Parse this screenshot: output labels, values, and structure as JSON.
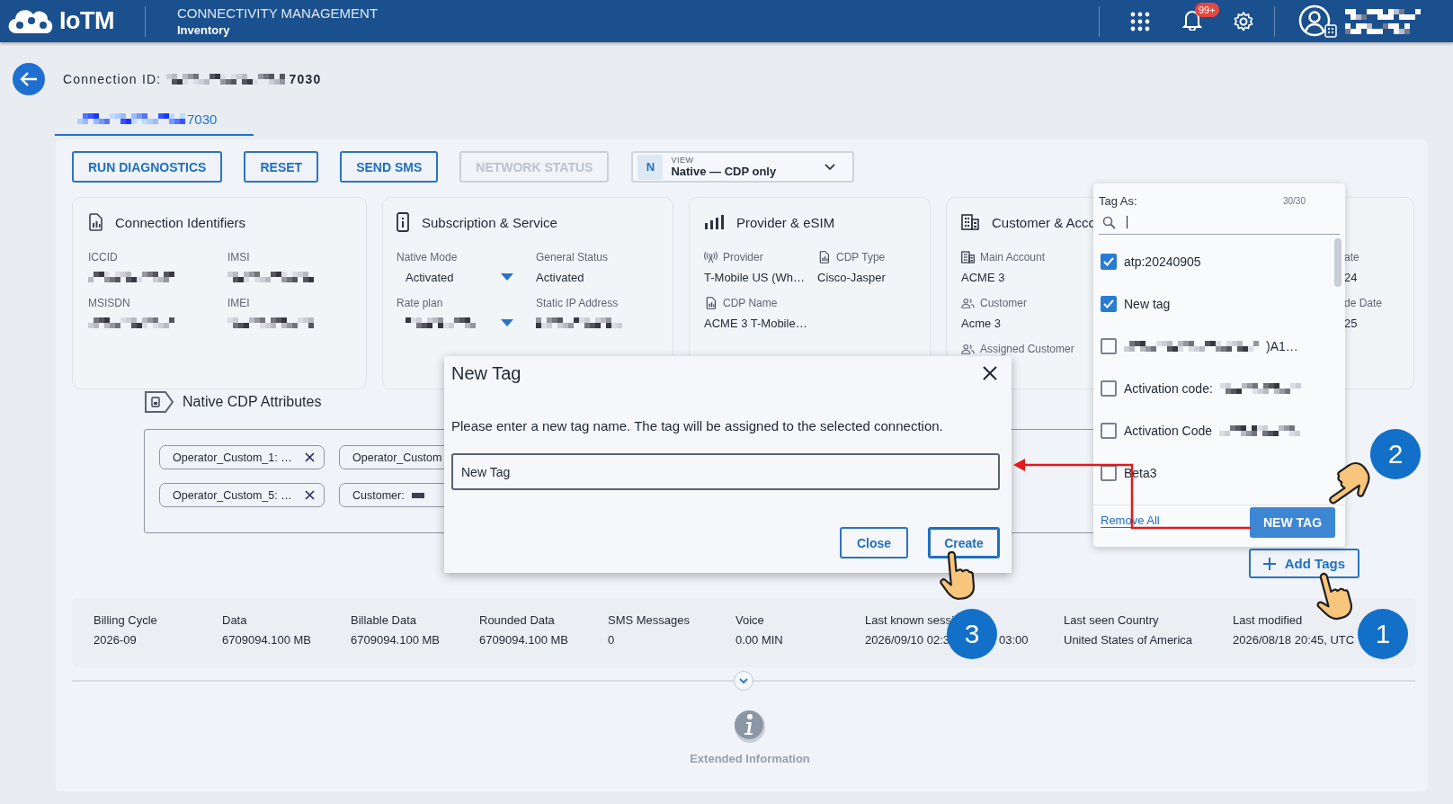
{
  "header": {
    "app_name": "IoTM",
    "section": "CONNECTIVITY MANAGEMENT",
    "page": "Inventory",
    "notification_badge": "99+"
  },
  "connection": {
    "label": "Connection ID:",
    "id_tail": "7030"
  },
  "tab": {
    "label_tail": "7030",
    "selected": true
  },
  "actions": [
    {
      "label": "RUN DIAGNOSTICS",
      "disabled": false
    },
    {
      "label": "RESET",
      "disabled": false
    },
    {
      "label": "SEND SMS",
      "disabled": false
    },
    {
      "label": "NETWORK STATUS",
      "disabled": true
    }
  ],
  "view_select": {
    "badge": "N",
    "caption": "VIEW",
    "value": "Native — CDP only"
  },
  "cards": [
    {
      "title": "Connection Identifiers",
      "fields": [
        {
          "label": "ICCID",
          "redacted": true
        },
        {
          "label": "IMSI",
          "redacted": true
        },
        {
          "label": "MSISDN",
          "redacted": true
        },
        {
          "label": "IMEI",
          "redacted": true
        }
      ]
    },
    {
      "title": "Subscription & Service",
      "fields": [
        {
          "label": "Native Mode",
          "value": "Activated",
          "dropdown": true
        },
        {
          "label": "General Status",
          "value": "Activated"
        },
        {
          "label": "Rate plan",
          "redacted": true,
          "dropdown": true
        },
        {
          "label": "Static IP Address",
          "redacted": true
        }
      ]
    },
    {
      "title": "Provider & eSIM",
      "fields": [
        {
          "label": "Provider",
          "value": "T-Mobile US (Wh…"
        },
        {
          "label": "CDP Type",
          "value": "Cisco-Jasper"
        },
        {
          "label": "CDP Name",
          "value": "ACME 3 T-Mobile…"
        }
      ]
    },
    {
      "title": "Customer & Acco",
      "fields": [
        {
          "label": "Main Account",
          "value": "ACME 3"
        },
        {
          "label": "Customer",
          "value": "Acme 3"
        },
        {
          "label": "Assigned Customer"
        }
      ]
    },
    {
      "fields": [
        {
          "label": "ate",
          "value": "24"
        },
        {
          "label": "de Date",
          "value": "25"
        }
      ]
    }
  ],
  "attributes": {
    "title": "Native CDP Attributes",
    "chips": [
      {
        "label": "Operator_Custom_1: …",
        "removable": true
      },
      {
        "label": "Operator_Custom"
      },
      {
        "label": "Operator_Custom_5: …",
        "removable": true
      },
      {
        "label": "Customer:",
        "redacted": true
      }
    ]
  },
  "add_tags": "Add Tags",
  "stats": [
    {
      "label": "Billing Cycle",
      "value": "2026-09"
    },
    {
      "label": "Data",
      "value": "6709094.100 MB"
    },
    {
      "label": "Billable Data",
      "value": "6709094.100 MB"
    },
    {
      "label": "Rounded Data",
      "value": "6709094.100 MB"
    },
    {
      "label": "SMS Messages",
      "value": "0"
    },
    {
      "label": "Voice",
      "value": "0.00 MIN"
    },
    {
      "label": "Last known sessi",
      "value": "2026/09/10 02:3",
      "value_tail": "03:00"
    },
    {
      "label": "Last seen Country",
      "value": "United States of America"
    },
    {
      "label": "Last modified",
      "value": "2026/08/18 20:45, UTC"
    }
  ],
  "extended": "Extended Information",
  "tag_menu": {
    "title": "Tag As:",
    "count": "30/30",
    "options": [
      {
        "label": "atp:20240905",
        "checked": true
      },
      {
        "label": "New tag",
        "checked": true
      },
      {
        "label": ")A1…",
        "checked": false,
        "kind": "masked_prefix"
      },
      {
        "label": "Activation code:",
        "checked": false,
        "kind": "masked_suffix"
      },
      {
        "label": "Activation Code",
        "checked": false,
        "kind": "masked_suffix"
      },
      {
        "label": "Beta3",
        "checked": false
      }
    ],
    "remove_all": "Remove All",
    "new_tag": "NEW TAG"
  },
  "dialog": {
    "title": "New Tag",
    "message": "Please enter a new tag name. The tag will be assigned to the selected connection.",
    "input_value": "New Tag",
    "buttons": [
      {
        "label": "Close",
        "kind": "outline"
      },
      {
        "label": "Create",
        "kind": "focused"
      }
    ]
  },
  "tutorial": {
    "steps": [
      {
        "number": "1"
      },
      {
        "number": "2"
      },
      {
        "number": "3"
      }
    ]
  }
}
